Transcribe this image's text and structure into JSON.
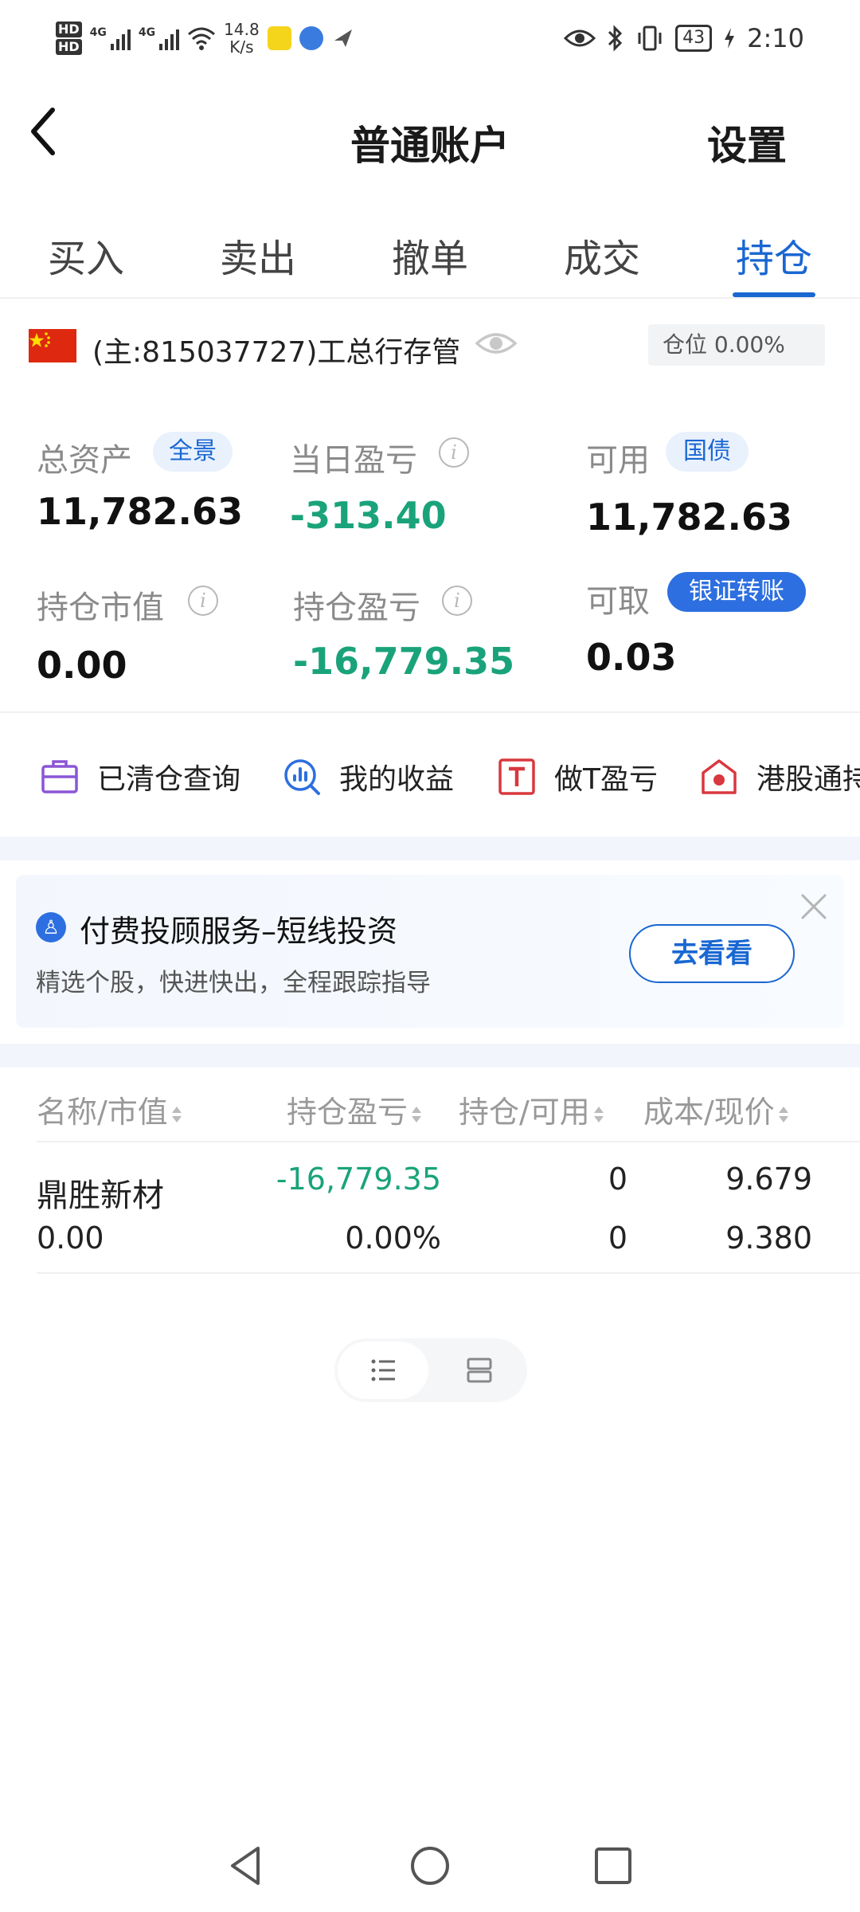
{
  "status_bar": {
    "hd1": "HD",
    "hd2": "HD",
    "net1": "4G",
    "net2": "4G",
    "speed_value": "14.8",
    "speed_unit": "K/s",
    "battery": "43",
    "time": "2:10"
  },
  "header": {
    "title": "普通账户",
    "settings_label": "设置"
  },
  "tabs": [
    {
      "label": "买入"
    },
    {
      "label": "卖出"
    },
    {
      "label": "撤单"
    },
    {
      "label": "成交"
    },
    {
      "label": "持仓"
    }
  ],
  "active_tab": "持仓",
  "account": {
    "name": "(主:815037727)工总行存管",
    "position_label": "仓位 0.00%"
  },
  "stats": {
    "total_assets": {
      "label": "总资产",
      "badge": "全景",
      "value": "11,782.63"
    },
    "daily_pl": {
      "label": "当日盈亏",
      "value": "-313.40"
    },
    "available": {
      "label": "可用",
      "badge": "国债",
      "value": "11,782.63"
    },
    "holding_value": {
      "label": "持仓市值",
      "value": "0.00"
    },
    "holding_pl": {
      "label": "持仓盈亏",
      "value": "-16,779.35"
    },
    "withdrawable": {
      "label": "可取",
      "badge": "银证转账",
      "value": "0.03"
    }
  },
  "shortcuts": [
    {
      "label": "已清仓查询"
    },
    {
      "label": "我的收益"
    },
    {
      "label": "做T盈亏"
    },
    {
      "label": "港股通持"
    }
  ],
  "promo": {
    "title": "付费投顾服务–短线投资",
    "subtitle": "精选个股，快进快出，全程跟踪指导",
    "button": "去看看"
  },
  "table": {
    "headers": [
      "名称/市值",
      "持仓盈亏",
      "持仓/可用",
      "成本/现价"
    ],
    "rows": [
      {
        "name": "鼎胜新材",
        "market_value": "0.00",
        "pl": "-16,779.35",
        "pl_pct": "0.00%",
        "holding": "0",
        "available": "0",
        "cost": "9.679",
        "price": "9.380"
      }
    ]
  },
  "colors": {
    "accent": "#1967d2",
    "positive_green": "#1aa37a",
    "flag_red": "#de2910"
  }
}
